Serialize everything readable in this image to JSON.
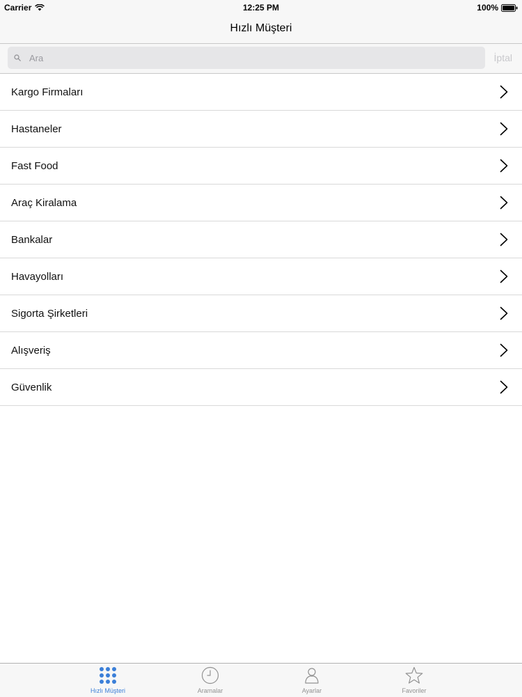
{
  "status_bar": {
    "carrier": "Carrier",
    "time": "12:25 PM",
    "battery": "100%"
  },
  "nav": {
    "title": "Hızlı Müşteri"
  },
  "search": {
    "placeholder": "Ara",
    "value": "",
    "cancel_label": "İptal"
  },
  "list": {
    "items": [
      {
        "label": "Kargo Firmaları"
      },
      {
        "label": "Hastaneler"
      },
      {
        "label": "Fast Food"
      },
      {
        "label": "Araç Kiralama"
      },
      {
        "label": "Bankalar"
      },
      {
        "label": "Havayolları"
      },
      {
        "label": "Sigorta Şirketleri"
      },
      {
        "label": "Alışveriş"
      },
      {
        "label": "Güvenlik"
      }
    ]
  },
  "tabs": [
    {
      "label": "Hızlı Müşteri",
      "icon": "grid-icon",
      "active": true
    },
    {
      "label": "Aramalar",
      "icon": "clock-icon",
      "active": false
    },
    {
      "label": "Ayarlar",
      "icon": "person-icon",
      "active": false
    },
    {
      "label": "Favoriler",
      "icon": "star-icon",
      "active": false
    }
  ],
  "colors": {
    "accent": "#3b7fd8",
    "inactive_tab": "#929292",
    "separator": "#d9d9d9",
    "bar_background": "#f7f7f7"
  }
}
